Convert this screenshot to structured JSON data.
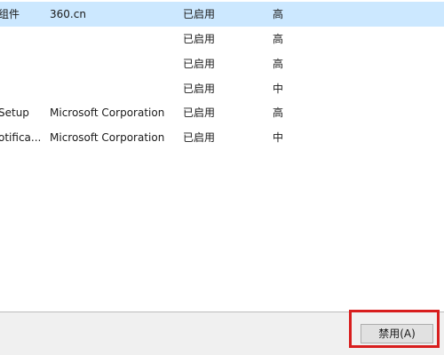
{
  "startup_list": {
    "rows": [
      {
        "name": "组件",
        "publisher": "360.cn",
        "status": "已启用",
        "impact": "高",
        "selected": true
      },
      {
        "name": "",
        "publisher": "",
        "status": "已启用",
        "impact": "高",
        "selected": false
      },
      {
        "name": "",
        "publisher": "",
        "status": "已启用",
        "impact": "高",
        "selected": false
      },
      {
        "name": "",
        "publisher": "",
        "status": "已启用",
        "impact": "中",
        "selected": false
      },
      {
        "name": "Setup",
        "publisher": "Microsoft Corporation",
        "status": "已启用",
        "impact": "高",
        "selected": false
      },
      {
        "name": "otifica...",
        "publisher": "Microsoft Corporation",
        "status": "已启用",
        "impact": "中",
        "selected": false
      }
    ]
  },
  "footer": {
    "disable_label": "禁用(A)"
  },
  "colors": {
    "selection": "#cce8ff",
    "highlight_border": "#d81e1e",
    "footer_bg": "#f0f0f0"
  }
}
